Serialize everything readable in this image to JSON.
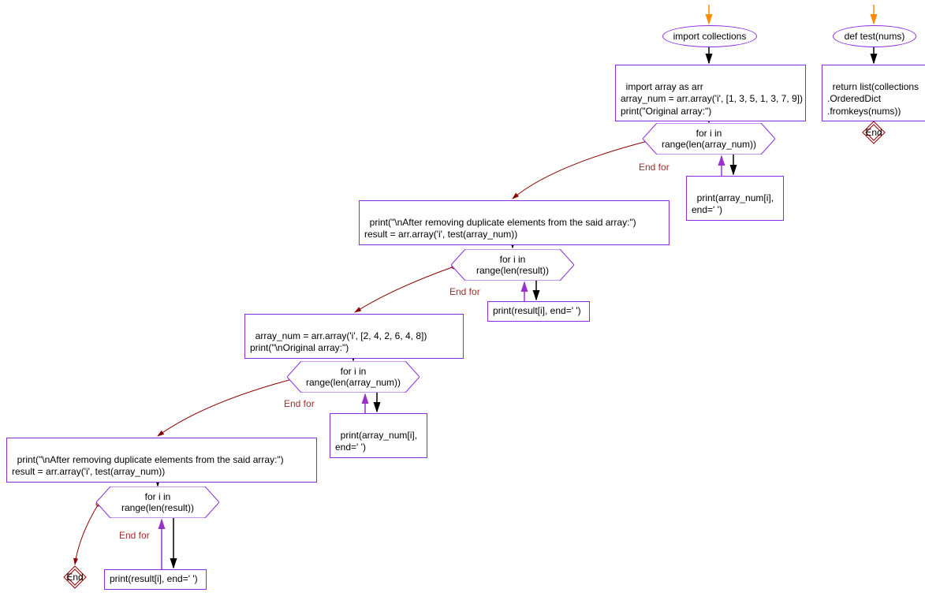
{
  "flowchart": {
    "nodes": {
      "start1": {
        "label": "import collections"
      },
      "start2": {
        "label": "def test(nums)"
      },
      "rect_right": {
        "text": "return list(collections\n.OrderedDict\n.fromkeys(nums))"
      },
      "rect1": {
        "text": "import array as arr\narray_num = arr.array('i', [1, 3, 5, 1, 3, 7, 9])\nprint(\"Original array:\")"
      },
      "hex1": {
        "text": "for i in\nrange(len(array_num))"
      },
      "rect_body1": {
        "text": "print(array_num[i],\nend=' ')"
      },
      "rect2": {
        "text": "print(\"\\nAfter removing duplicate elements from the said array:\")\nresult = arr.array('i', test(array_num))"
      },
      "hex2": {
        "text": "for i in\nrange(len(result))"
      },
      "rect_body2": {
        "text": "print(result[i], end=' ')"
      },
      "rect3": {
        "text": "array_num = arr.array('i', [2, 4, 2, 6, 4, 8])\nprint(\"\\nOriginal array:\")"
      },
      "hex3": {
        "text": "for i in\nrange(len(array_num))"
      },
      "rect_body3": {
        "text": "print(array_num[i],\nend=' ')"
      },
      "rect4": {
        "text": "print(\"\\nAfter removing duplicate elements from the said array:\")\nresult = arr.array('i', test(array_num))"
      },
      "hex4": {
        "text": "for i in\nrange(len(result))"
      },
      "rect_body4": {
        "text": "print(result[i], end=' ')"
      },
      "end1": {
        "label": "End"
      },
      "end2": {
        "label": "End"
      }
    },
    "labels": {
      "endfor1": "End for",
      "endfor2": "End for",
      "endfor3": "End for",
      "endfor4": "End for"
    },
    "colors": {
      "border": "#8A2BE2",
      "label": "#a52a2a",
      "arrow_black": "#000000",
      "arrow_orange": "#FF8C00",
      "arrow_purple": "#9932CC",
      "arrow_darkred": "#8B0000"
    }
  }
}
